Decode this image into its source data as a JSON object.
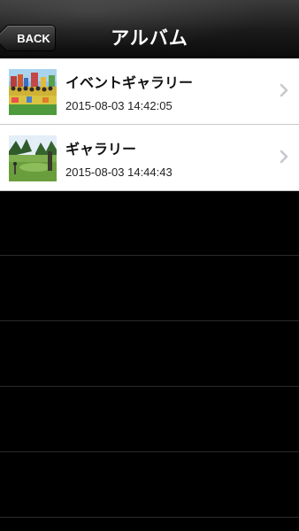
{
  "nav": {
    "title": "アルバム",
    "back_label": "BACK"
  },
  "albums": [
    {
      "title": "イベントギャラリー",
      "date": "2015-08-03 14:42:05",
      "thumb_icon": "event-group-photo"
    },
    {
      "title": "ギャラリー",
      "date": "2015-08-03 14:44:43",
      "thumb_icon": "golf-course-photo"
    }
  ],
  "colors": {
    "navbar": "#1a1a1a",
    "background": "#000000",
    "row_bg": "#ffffff",
    "chevron": "#c7c7cc"
  }
}
